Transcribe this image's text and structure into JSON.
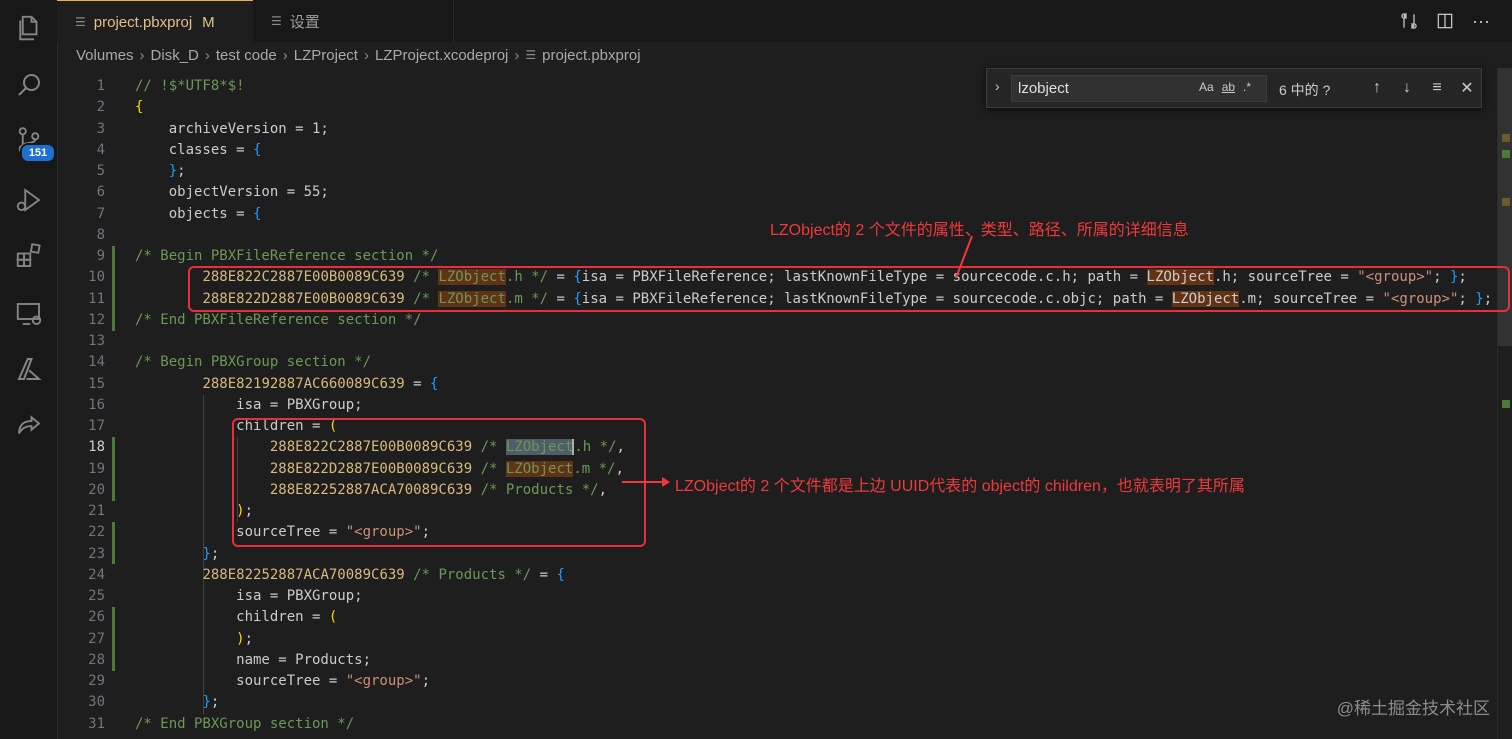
{
  "tabs": [
    {
      "label": "project.pbxproj",
      "modified": "M"
    },
    {
      "label": "设置"
    }
  ],
  "breadcrumb": [
    "Volumes",
    "Disk_D",
    "test code",
    "LZProject",
    "LZProject.xcodeproj",
    "project.pbxproj"
  ],
  "activity_bar": {
    "items": [
      "explorer-icon",
      "search-icon",
      "source-control-icon",
      "run-debug-icon",
      "extensions-icon",
      "remote-explorer-icon",
      "azure-icon",
      "live-share-icon"
    ],
    "source_control_badge": "151"
  },
  "find_widget": {
    "query": "lzobject",
    "match_case": "Aa",
    "whole_word": "ab",
    "regex": ".*",
    "result_count": "6 中的 ?"
  },
  "editor": {
    "lines": [
      {
        "n": "1",
        "segs": [
          {
            "c": "c",
            "t": "// !$*UTF8*$!"
          }
        ]
      },
      {
        "n": "2",
        "segs": [
          {
            "c": "b",
            "t": "{"
          }
        ]
      },
      {
        "n": "3",
        "segs": [
          {
            "c": "",
            "t": "    archiveVersion = 1;"
          }
        ]
      },
      {
        "n": "4",
        "segs": [
          {
            "c": "",
            "t": "    classes = "
          },
          {
            "c": "p",
            "t": "{"
          }
        ]
      },
      {
        "n": "5",
        "segs": [
          {
            "c": "",
            "t": "    "
          },
          {
            "c": "p",
            "t": "}"
          },
          {
            "c": "",
            "t": ";"
          }
        ]
      },
      {
        "n": "6",
        "segs": [
          {
            "c": "",
            "t": "    objectVersion = 55;"
          }
        ]
      },
      {
        "n": "7",
        "segs": [
          {
            "c": "",
            "t": "    objects = "
          },
          {
            "c": "p",
            "t": "{"
          }
        ]
      },
      {
        "n": "8",
        "segs": [
          {
            "c": "",
            "t": ""
          }
        ]
      },
      {
        "n": "9",
        "segs": [
          {
            "c": "c",
            "t": "/* Begin PBXFileReference section */"
          }
        ]
      },
      {
        "n": "10",
        "segs": [
          {
            "c": "",
            "t": "        "
          },
          {
            "c": "u",
            "t": "288E822C2887E00B0089C639"
          },
          {
            "c": "c",
            "t": " /* "
          },
          {
            "c": "c hl",
            "t": "LZObject"
          },
          {
            "c": "c",
            "t": ".h */"
          },
          {
            "c": "",
            "t": " = "
          },
          {
            "c": "p",
            "t": "{"
          },
          {
            "c": "",
            "t": "isa = PBXFileReference; lastKnownFileType = sourcecode.c.h; path = "
          },
          {
            "c": "hl",
            "t": "LZObject"
          },
          {
            "c": "",
            "t": ".h; sourceTree = "
          },
          {
            "c": "s",
            "t": "\"<group>\""
          },
          {
            "c": "",
            "t": "; "
          },
          {
            "c": "p",
            "t": "}"
          },
          {
            "c": "",
            "t": ";"
          }
        ]
      },
      {
        "n": "11",
        "segs": [
          {
            "c": "",
            "t": "        "
          },
          {
            "c": "u",
            "t": "288E822D2887E00B0089C639"
          },
          {
            "c": "c",
            "t": " /* "
          },
          {
            "c": "c hl",
            "t": "LZObject"
          },
          {
            "c": "c",
            "t": ".m */"
          },
          {
            "c": "",
            "t": " = "
          },
          {
            "c": "p",
            "t": "{"
          },
          {
            "c": "",
            "t": "isa = PBXFileReference; lastKnownFileType = sourcecode.c.objc; path = "
          },
          {
            "c": "hl",
            "t": "LZObject"
          },
          {
            "c": "",
            "t": ".m; sourceTree = "
          },
          {
            "c": "s",
            "t": "\"<group>\""
          },
          {
            "c": "",
            "t": "; "
          },
          {
            "c": "p",
            "t": "}"
          },
          {
            "c": "",
            "t": ";"
          }
        ]
      },
      {
        "n": "12",
        "segs": [
          {
            "c": "c",
            "t": "/* End PBXFileReference section */"
          }
        ]
      },
      {
        "n": "13",
        "segs": [
          {
            "c": "",
            "t": ""
          }
        ]
      },
      {
        "n": "14",
        "segs": [
          {
            "c": "c",
            "t": "/* Begin PBXGroup section */"
          }
        ]
      },
      {
        "n": "15",
        "segs": [
          {
            "c": "",
            "t": "        "
          },
          {
            "c": "u",
            "t": "288E82192887AC660089C639"
          },
          {
            "c": "",
            "t": " = "
          },
          {
            "c": "p",
            "t": "{"
          }
        ]
      },
      {
        "n": "16",
        "segs": [
          {
            "c": "",
            "t": "            isa = PBXGroup;"
          }
        ]
      },
      {
        "n": "17",
        "segs": [
          {
            "c": "",
            "t": "            children = "
          },
          {
            "c": "b",
            "t": "("
          }
        ]
      },
      {
        "n": "18",
        "segs": [
          {
            "c": "",
            "t": "                "
          },
          {
            "c": "u",
            "t": "288E822C2887E00B0089C639"
          },
          {
            "c": "c",
            "t": " /* "
          },
          {
            "c": "c hlc",
            "t": "LZObject"
          },
          {
            "c": "c cursor",
            "t": ".h */"
          },
          {
            "c": "",
            "t": ","
          }
        ]
      },
      {
        "n": "19",
        "segs": [
          {
            "c": "",
            "t": "                "
          },
          {
            "c": "u",
            "t": "288E822D2887E00B0089C639"
          },
          {
            "c": "c",
            "t": " /* "
          },
          {
            "c": "c hl",
            "t": "LZObject"
          },
          {
            "c": "c",
            "t": ".m */"
          },
          {
            "c": "",
            "t": ","
          }
        ]
      },
      {
        "n": "20",
        "segs": [
          {
            "c": "",
            "t": "                "
          },
          {
            "c": "u",
            "t": "288E82252887ACA70089C639"
          },
          {
            "c": "c",
            "t": " /* Products */"
          },
          {
            "c": "",
            "t": ","
          }
        ]
      },
      {
        "n": "21",
        "segs": [
          {
            "c": "",
            "t": "            "
          },
          {
            "c": "b",
            "t": ")"
          },
          {
            "c": "",
            "t": ";"
          }
        ]
      },
      {
        "n": "22",
        "segs": [
          {
            "c": "",
            "t": "            sourceTree = "
          },
          {
            "c": "s",
            "t": "\"<group>\""
          },
          {
            "c": "",
            "t": ";"
          }
        ]
      },
      {
        "n": "23",
        "segs": [
          {
            "c": "",
            "t": "        "
          },
          {
            "c": "p",
            "t": "}"
          },
          {
            "c": "",
            "t": ";"
          }
        ]
      },
      {
        "n": "24",
        "segs": [
          {
            "c": "",
            "t": "        "
          },
          {
            "c": "u",
            "t": "288E82252887ACA70089C639"
          },
          {
            "c": "c",
            "t": " /* Products */"
          },
          {
            "c": "",
            "t": " = "
          },
          {
            "c": "p",
            "t": "{"
          }
        ]
      },
      {
        "n": "25",
        "segs": [
          {
            "c": "",
            "t": "            isa = PBXGroup;"
          }
        ]
      },
      {
        "n": "26",
        "segs": [
          {
            "c": "",
            "t": "            children = "
          },
          {
            "c": "b",
            "t": "("
          }
        ]
      },
      {
        "n": "27",
        "segs": [
          {
            "c": "",
            "t": "            "
          },
          {
            "c": "b",
            "t": ")"
          },
          {
            "c": "",
            "t": ";"
          }
        ]
      },
      {
        "n": "28",
        "segs": [
          {
            "c": "",
            "t": "            name = Products;"
          }
        ]
      },
      {
        "n": "29",
        "segs": [
          {
            "c": "",
            "t": "            sourceTree = "
          },
          {
            "c": "s",
            "t": "\"<group>\""
          },
          {
            "c": "",
            "t": ";"
          }
        ]
      },
      {
        "n": "30",
        "segs": [
          {
            "c": "",
            "t": "        "
          },
          {
            "c": "p",
            "t": "}"
          },
          {
            "c": "",
            "t": ";"
          }
        ]
      },
      {
        "n": "31",
        "segs": [
          {
            "c": "c",
            "t": "/* End PBXGroup section */"
          }
        ]
      }
    ],
    "current_line": "18"
  },
  "annotations": {
    "note1": "LZObject的 2 个文件的属性、类型、路径、所属的详细信息",
    "note2": "LZObject的 2 个文件都是上边 UUID代表的 object的 children，也就表明了其所属",
    "color": "#f0393c"
  },
  "watermark": "@稀土掘金技术社区",
  "colors": {
    "background": "#1e1e1e",
    "comment": "#6a9955",
    "string": "#ce9178",
    "match_highlight": "#613214",
    "modified_tab": "#e2c08d"
  }
}
